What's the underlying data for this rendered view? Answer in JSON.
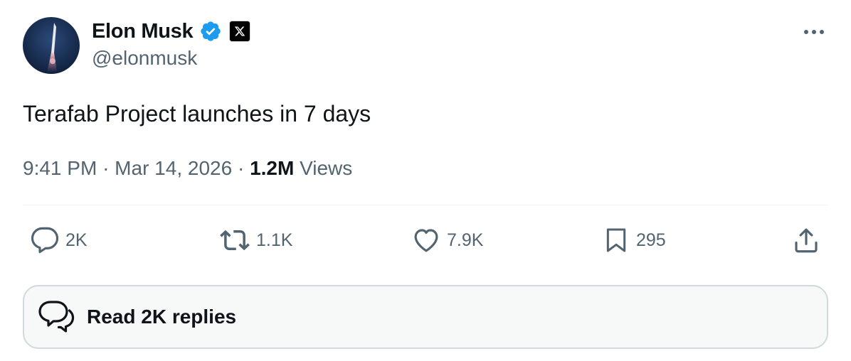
{
  "author": {
    "display_name": "Elon Musk",
    "handle": "@elonmusk",
    "verified_icon": "verified-badge-icon",
    "affiliation_icon": "x-logo-icon",
    "avatar": "rocket-launch-avatar"
  },
  "tweet": {
    "text": "Terafab Project launches in 7 days",
    "time": "9:41 PM",
    "separator": "·",
    "date": "Mar 14, 2026",
    "views_count": "1.2M",
    "views_label": "Views"
  },
  "actions": {
    "reply_count": "2K",
    "retweet_count": "1.1K",
    "like_count": "7.9K",
    "bookmark_count": "295"
  },
  "replies_button": {
    "label": "Read 2K replies"
  },
  "colors": {
    "text_primary": "#0f1419",
    "text_secondary": "#536471",
    "verified_blue": "#1d9bf0",
    "border": "#cfd9de",
    "panel_bg": "#f7f9f9"
  }
}
